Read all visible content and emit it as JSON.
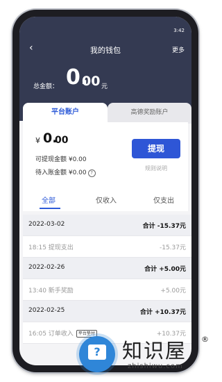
{
  "status_bar": {
    "time": "3:42"
  },
  "nav": {
    "back_icon": "back-arrow-icon",
    "title": "我的钱包",
    "more": "更多"
  },
  "total": {
    "label": "总金额：",
    "int": "0.",
    "dec": "00",
    "unit": "元"
  },
  "account_tabs": [
    {
      "label": "平台账户",
      "active": true
    },
    {
      "label": "高德奖励账户",
      "active": false
    }
  ],
  "balance": {
    "currency": "¥",
    "int": "0.",
    "dec": "00",
    "withdrawable": "可提现金额 ¥0.00",
    "pending": "待入账金额 ¥0.00"
  },
  "actions": {
    "withdraw": "提现",
    "rules": "规则说明"
  },
  "filters": [
    {
      "label": "全部",
      "active": true
    },
    {
      "label": "仅收入",
      "active": false
    },
    {
      "label": "仅支出",
      "active": false
    }
  ],
  "records": [
    {
      "type": "date",
      "left": "2022-03-02",
      "right": "合计 -15.37元"
    },
    {
      "type": "item",
      "left": "18:15  提现支出",
      "right": "-15.37元"
    },
    {
      "type": "date",
      "left": "2022-02-26",
      "right": "合计 +5.00元"
    },
    {
      "type": "item",
      "left": "13:40  新手奖励",
      "right": "+5.00元"
    },
    {
      "type": "date",
      "left": "2022-02-25",
      "right": "合计 +10.37元"
    },
    {
      "type": "item",
      "left": "16:05  订单收入",
      "tag": "平台垫付",
      "right": "+10.37元"
    }
  ],
  "watermark": {
    "text": "知识屋",
    "url": "zhishiwu.com",
    "reg": "®"
  },
  "colors": {
    "header": "#343a52",
    "accent": "#2e56d6"
  }
}
